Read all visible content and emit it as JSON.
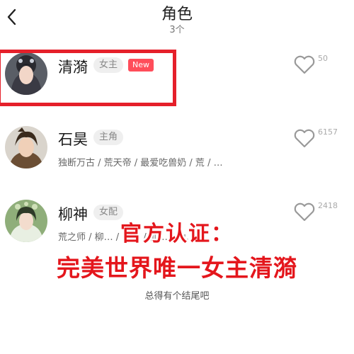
{
  "header": {
    "title": "角色",
    "count": "3个"
  },
  "characters": [
    {
      "name": "清漪",
      "tag": "女主",
      "badge": "New",
      "likes": "50",
      "description": ""
    },
    {
      "name": "石昊",
      "tag": "主角",
      "badge": "",
      "likes": "6157",
      "description": "独断万古 / 荒天帝 / 最爱吃兽奶 / 荒 / …"
    },
    {
      "name": "柳神",
      "tag": "女配",
      "badge": "",
      "likes": "2418",
      "description": "荒之师 / 柳… / …… / 仙… / 仙…"
    }
  ],
  "overlay": {
    "line1": "官方认证：",
    "line2": "完美世界唯一女主清漪"
  },
  "footer": "总得有个结尾吧",
  "colors": {
    "accent_red": "#e4161c",
    "new_badge": "#ff4d5a",
    "tag_bg": "#efefef"
  }
}
